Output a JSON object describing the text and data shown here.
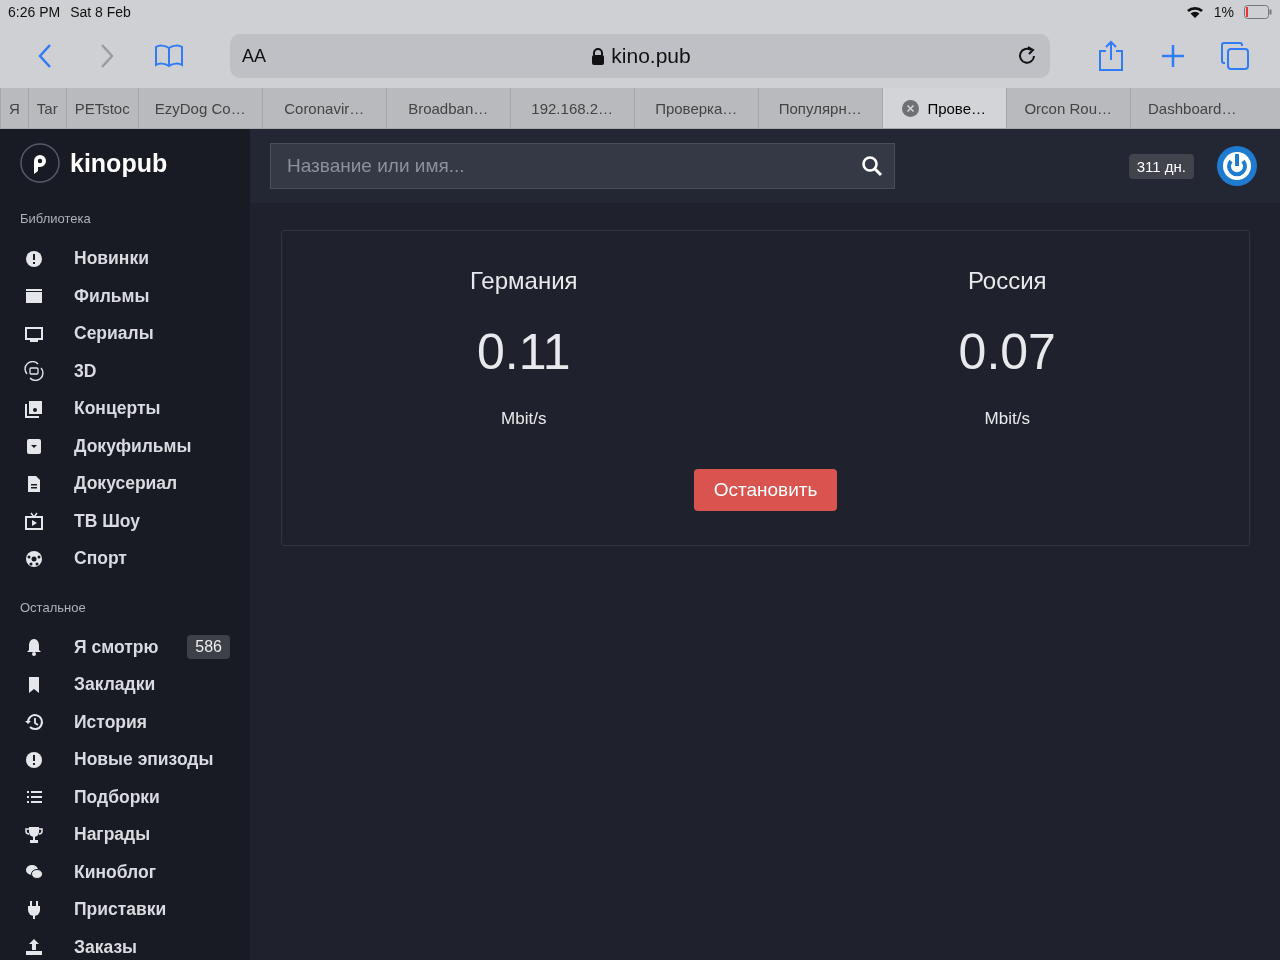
{
  "status_bar": {
    "time": "6:26 PM",
    "date": "Sat 8 Feb",
    "battery": "1%"
  },
  "toolbar": {
    "back": {
      "disabled": false
    },
    "forward": {
      "disabled": true
    },
    "text_size": "AA",
    "url": "kino.pub"
  },
  "tabs": [
    {
      "label": "Я",
      "selected": false
    },
    {
      "label": "Tar",
      "selected": false
    },
    {
      "label": "PETstoc",
      "selected": false
    },
    {
      "label": "EzyDog Co…",
      "selected": false
    },
    {
      "label": "Coronavir…",
      "selected": false
    },
    {
      "label": "Broadban…",
      "selected": false
    },
    {
      "label": "192.168.2…",
      "selected": false
    },
    {
      "label": "Проверка…",
      "selected": false
    },
    {
      "label": "Популярн…",
      "selected": false
    },
    {
      "label": "Прове…",
      "selected": true
    },
    {
      "label": "Orcon Rou…",
      "selected": false
    },
    {
      "label": "Dashboard…",
      "selected": false
    }
  ],
  "logo": "kinopub",
  "sidebar": [
    {
      "title": "Библиотека",
      "items": [
        {
          "label": "Новинки"
        },
        {
          "label": "Фильмы"
        },
        {
          "label": "Сериалы"
        },
        {
          "label": "3D"
        },
        {
          "label": "Концерты"
        },
        {
          "label": "Докуфильмы"
        },
        {
          "label": "Докусериал"
        },
        {
          "label": "ТВ Шоу"
        },
        {
          "label": "Спорт"
        }
      ]
    },
    {
      "title": "Остальное",
      "items": [
        {
          "label": "Я смотрю",
          "badge": "586"
        },
        {
          "label": "Закладки"
        },
        {
          "label": "История"
        },
        {
          "label": "Новые эпизоды"
        },
        {
          "label": "Подборки"
        },
        {
          "label": "Награды"
        },
        {
          "label": "Киноблог"
        },
        {
          "label": "Приставки"
        },
        {
          "label": "Заказы"
        }
      ]
    }
  ],
  "search": {
    "placeholder": "Название или имя..."
  },
  "subscription_badge": "311 дн.",
  "speed_test": {
    "servers": [
      {
        "name": "Германия",
        "value": "0.11",
        "unit": "Mbit/s"
      },
      {
        "name": "Россия",
        "value": "0.07",
        "unit": "Mbit/s"
      }
    ],
    "button": "Остановить"
  }
}
